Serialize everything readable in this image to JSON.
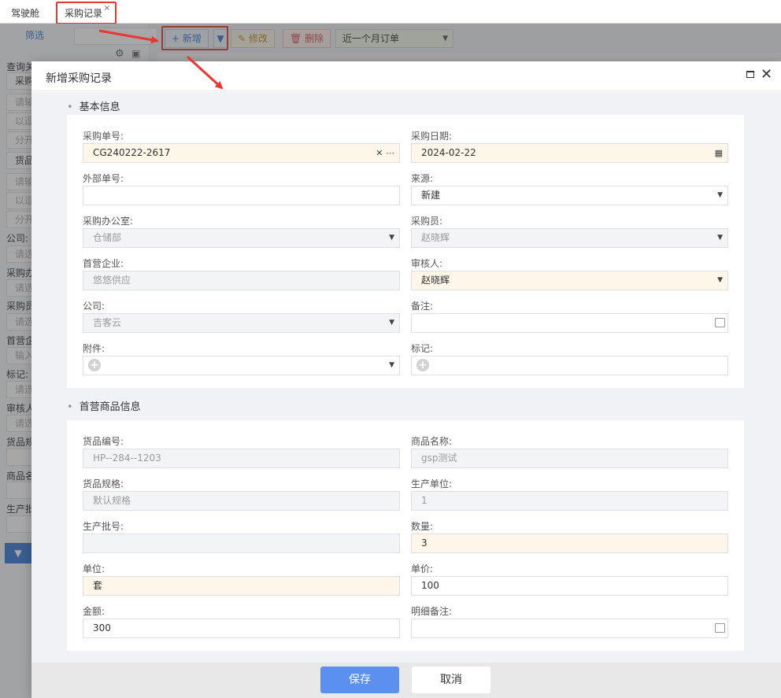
{
  "tabs": [
    {
      "label": "驾驶舱"
    },
    {
      "label": "采购记录",
      "close": "×"
    }
  ],
  "sidebar": {
    "filter_label": "筛选",
    "labels": [
      "查询关",
      "采购",
      "货品",
      "公司:",
      "采购办",
      "采购员",
      "首营企",
      "标记:",
      "审核人",
      "货品规",
      "商品名",
      "生产批"
    ],
    "placeholders": [
      "请输",
      "以逗",
      "分开",
      "请输",
      "以逗",
      "分开",
      "请选",
      "请选",
      "请选",
      "输入",
      "请选",
      "请选"
    ]
  },
  "toolbar": {
    "new_label": "新增",
    "edit_label": "修改",
    "delete_label": "删除",
    "range_value": "近一个月订单"
  },
  "modal": {
    "title": "新增采购记录",
    "section_basic": "基本信息",
    "section_goods": "首营商品信息",
    "basic": {
      "order_no": {
        "label": "采购单号:",
        "value": "CG240222-2617"
      },
      "order_date": {
        "label": "采购日期:",
        "value": "2024-02-22"
      },
      "external_no": {
        "label": "外部单号:",
        "value": ""
      },
      "source": {
        "label": "来源:",
        "value": "新建"
      },
      "office": {
        "label": "采购办公室:",
        "value": "仓储部"
      },
      "buyer": {
        "label": "采购员:",
        "value": "赵晓辉"
      },
      "first_company": {
        "label": "首营企业:",
        "value": "悠悠供应"
      },
      "reviewer": {
        "label": "审核人:",
        "value": "赵晓辉"
      },
      "company": {
        "label": "公司:",
        "value": "吉客云"
      },
      "remark": {
        "label": "备注:",
        "value": ""
      },
      "attachment": {
        "label": "附件:"
      },
      "tag": {
        "label": "标记:"
      }
    },
    "goods": {
      "goods_no": {
        "label": "货品编号:",
        "value": "HP--284--1203"
      },
      "product_name": {
        "label": "商品名称:",
        "value": "gsp测试"
      },
      "spec": {
        "label": "货品规格:",
        "value": "默认规格"
      },
      "prod_unit": {
        "label": "生产单位:",
        "value": "1"
      },
      "batch_no": {
        "label": "生产批号:",
        "value": ""
      },
      "quantity": {
        "label": "数量:",
        "value": "3"
      },
      "unit": {
        "label": "单位:",
        "value": "套"
      },
      "unit_price": {
        "label": "单价:",
        "value": "100"
      },
      "amount": {
        "label": "金额:",
        "value": "300"
      },
      "detail_remark": {
        "label": "明细备注:",
        "value": ""
      }
    },
    "save_label": "保存",
    "cancel_label": "取消"
  },
  "colors": {
    "accent": "#5b8ff0",
    "required_bg": "#fdf6e9",
    "highlight": "#e53935"
  }
}
